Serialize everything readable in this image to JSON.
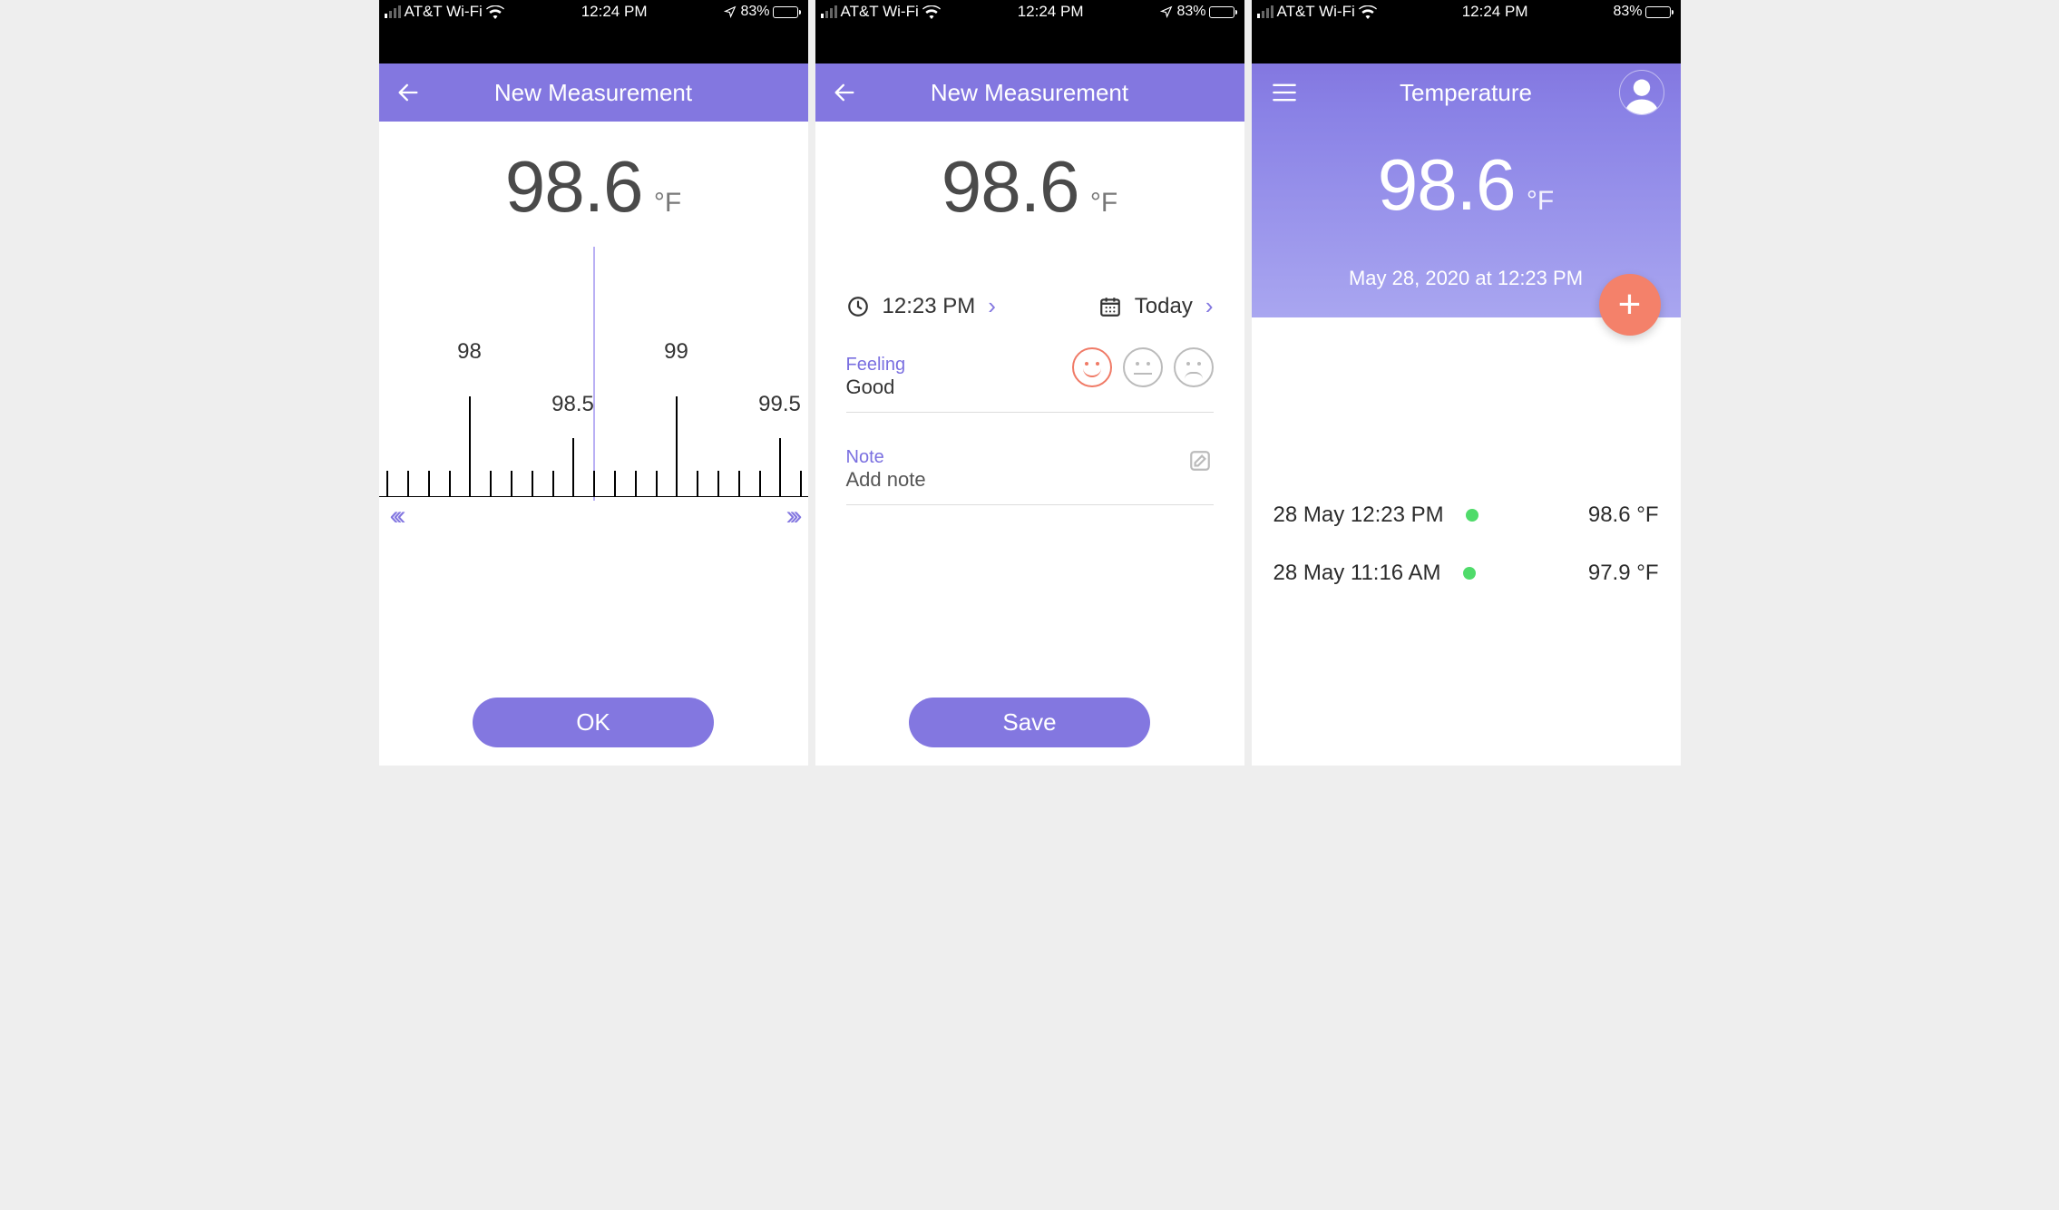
{
  "status": {
    "carrier": "AT&T Wi-Fi",
    "time": "12:24 PM",
    "battery_pct": "83%",
    "battery_fill_pct": 83,
    "signal_active_bars": 1
  },
  "screen1": {
    "title": "New Measurement",
    "temp_value": "98.6",
    "temp_unit": "°F",
    "ruler": {
      "major_left": "98",
      "half_left": "98.5",
      "major_right": "99",
      "half_right": "99.5"
    },
    "ok_label": "OK"
  },
  "screen2": {
    "title": "New Measurement",
    "temp_value": "98.6",
    "temp_unit": "°F",
    "time_value": "12:23 PM",
    "date_value": "Today",
    "feeling_label": "Feeling",
    "feeling_value": "Good",
    "note_label": "Note",
    "note_placeholder": "Add note",
    "save_label": "Save"
  },
  "screen3": {
    "title": "Temperature",
    "temp_value": "98.6",
    "temp_unit": "°F",
    "datetime": "May 28, 2020 at 12:23 PM",
    "entries": [
      {
        "date": "28 May 12:23 PM",
        "value": "98.6 °F"
      },
      {
        "date": "28 May 11:16 AM",
        "value": "97.9 °F"
      }
    ]
  }
}
